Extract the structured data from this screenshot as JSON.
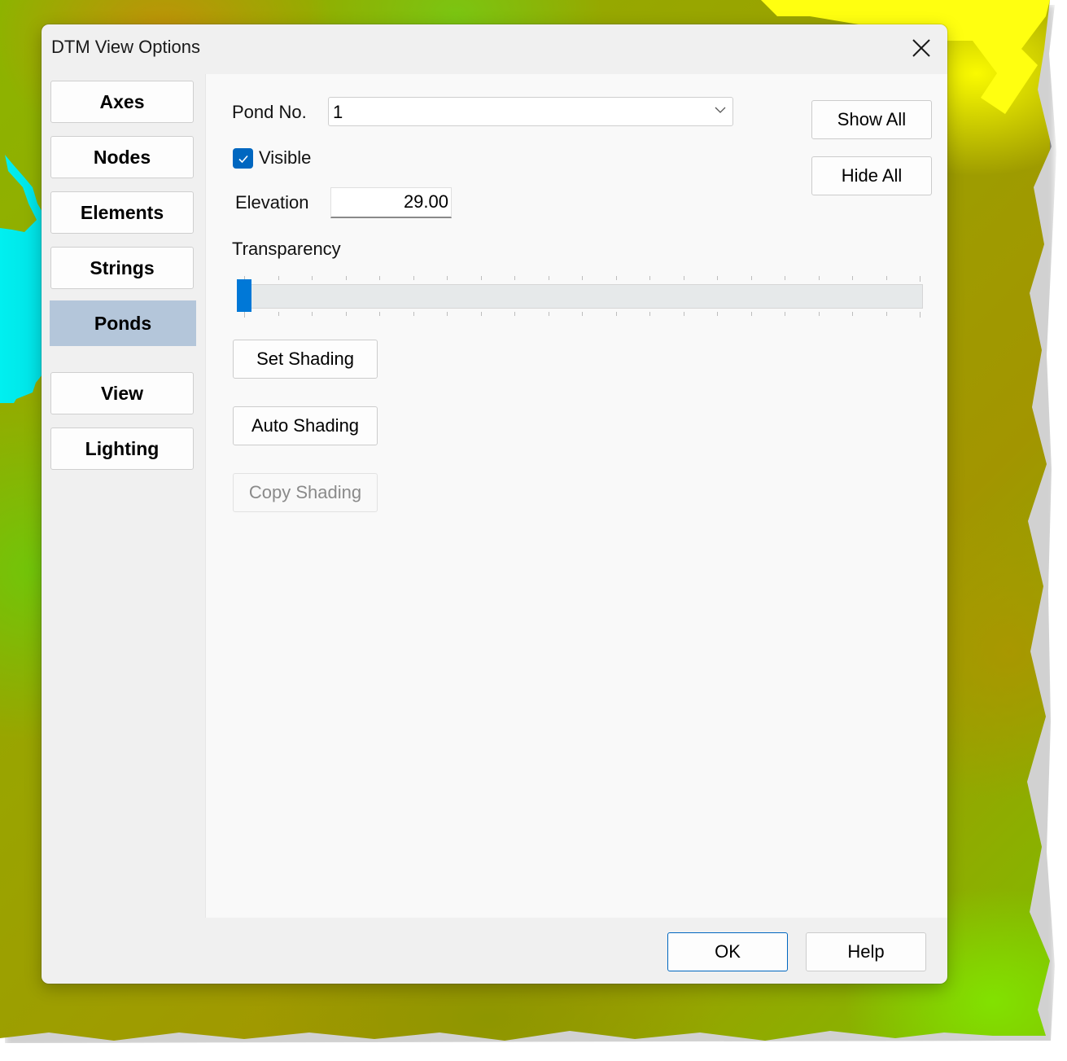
{
  "dialog": {
    "title": "DTM View Options",
    "close_icon": "close-icon"
  },
  "sidebar": {
    "items": [
      {
        "label": "Axes",
        "active": false
      },
      {
        "label": "Nodes",
        "active": false
      },
      {
        "label": "Elements",
        "active": false
      },
      {
        "label": "Strings",
        "active": false
      },
      {
        "label": "Ponds",
        "active": true
      },
      {
        "label": "View",
        "active": false
      },
      {
        "label": "Lighting",
        "active": false
      }
    ],
    "active_color": "#b4c6da"
  },
  "ponds": {
    "pond_no_label": "Pond No.",
    "pond_no_value": "1",
    "visible_label": "Visible",
    "visible_checked": true,
    "elevation_label": "Elevation",
    "elevation_value": "29.00",
    "transparency_label": "Transparency",
    "transparency_value_fraction": 0.0,
    "transparency_tick_count": 21,
    "show_all_label": "Show All",
    "hide_all_label": "Hide All",
    "set_shading_label": "Set Shading",
    "auto_shading_label": "Auto Shading",
    "copy_shading_label": "Copy Shading",
    "copy_shading_enabled": false
  },
  "footer": {
    "ok_label": "OK",
    "help_label": "Help"
  },
  "colors": {
    "accent": "#0067c0",
    "slider_thumb": "#0078d7",
    "water": "#00f0f0",
    "terrain_yellow": "#ffff10"
  }
}
